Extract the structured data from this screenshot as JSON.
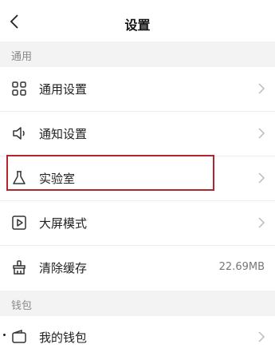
{
  "header": {
    "title": "设置"
  },
  "sections": {
    "general": "通用",
    "wallet": "钱包"
  },
  "rows": [
    {
      "label": "通用设置",
      "icon": "grid-icon",
      "value": ""
    },
    {
      "label": "通知设置",
      "icon": "speaker-icon",
      "value": ""
    },
    {
      "label": "实验室",
      "icon": "flask-icon",
      "value": ""
    },
    {
      "label": "大屏模式",
      "icon": "play-square-icon",
      "value": ""
    },
    {
      "label": "清除缓存",
      "icon": "broom-icon",
      "value": "22.69MB"
    },
    {
      "label": "我的钱包",
      "icon": "wallet-icon",
      "value": ""
    }
  ],
  "colors": {
    "highlight": "#b3262d",
    "section_bg": "#f3f3f3"
  }
}
